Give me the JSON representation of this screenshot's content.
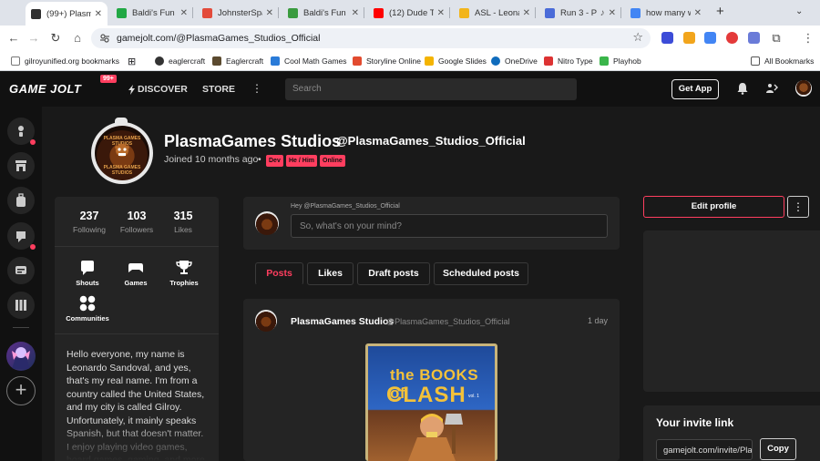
{
  "browser": {
    "tabs": [
      {
        "title": "(99+) Plasma",
        "color": "#2f2f2f",
        "active": true
      },
      {
        "title": "Baldi's Fun N",
        "color": "#22a845",
        "active": false
      },
      {
        "title": "JohnsterSpa",
        "color": "#e34b3b",
        "active": false
      },
      {
        "title": "Baldi's Fun N",
        "color": "#3a9b3f",
        "active": false
      },
      {
        "title": "(12) Dude Th",
        "color": "#ff0000",
        "active": false
      },
      {
        "title": "ASL - Leona",
        "color": "#f2b51c",
        "active": false
      },
      {
        "title": "Run 3 - Pl",
        "color": "#4a6bd8",
        "active": false
      },
      {
        "title": "how many w",
        "color": "#4285f4",
        "active": false
      }
    ],
    "new_tab": "+",
    "tab_menu": "⌄",
    "url": "gamejolt.com/@PlasmaGames_Studios_Official",
    "bookmarks": [
      {
        "label": "gilroyunified.org bookmarks",
        "color": "#777"
      },
      {
        "label": "eaglercraft",
        "color": "#333"
      },
      {
        "label": "Eaglercraft",
        "color": "#5b4a2f"
      },
      {
        "label": "Cool Math Games",
        "color": "#2a7bd8"
      },
      {
        "label": "Storyline Online",
        "color": "#e24b2f"
      },
      {
        "label": "Google Slides",
        "color": "#f4b400"
      },
      {
        "label": "OneDrive",
        "color": "#0f6cbd"
      },
      {
        "label": "Nitro Type",
        "color": "#d33"
      },
      {
        "label": "Playhob",
        "color": "#3ab54a"
      }
    ],
    "all_bookmarks": "All Bookmarks",
    "extension_colors": [
      "#3c4cd8",
      "#f2a51c",
      "#4285f4",
      "#e43a3a",
      "#6a7bd8"
    ]
  },
  "site": {
    "logo": "GAME JOLT",
    "notif_badge": "99+",
    "nav": {
      "discover": "DISCOVER",
      "store": "STORE"
    },
    "search_placeholder": "Search",
    "get_app": "Get App"
  },
  "profile": {
    "display_name": "PlasmaGames Studios",
    "handle": "@PlasmaGames_Studios_Official",
    "joined": "Joined 10 months ago",
    "tags": [
      "Dev",
      "He / Him",
      "Online"
    ],
    "stats": [
      {
        "value": "237",
        "label": "Following"
      },
      {
        "value": "103",
        "label": "Followers"
      },
      {
        "value": "315",
        "label": "Likes"
      }
    ],
    "quick_links": [
      "Shouts",
      "Games",
      "Trophies",
      "Communities"
    ],
    "bio": "Hello everyone, my name is Leonardo Sandoval, and yes, that's my real name. I'm from a country called the United States, and my city is called Gilroy. Unfortunately, it mainly speaks Spanish, but that doesn't matter. I enjoy playing video games, board games, gaming, and more. It's",
    "avatar_text": [
      "PLASMA GAMES STUDIOS",
      "PLASMA GAMES STUDIOS"
    ]
  },
  "composer": {
    "greeting": "Hey @PlasmaGames_Studios_Official",
    "placeholder": "So, what's on your mind?"
  },
  "feed_tabs": [
    "Posts",
    "Likes",
    "Draft posts",
    "Scheduled posts"
  ],
  "post": {
    "author": "PlasmaGames Studios",
    "handle": "@PlasmaGames_Studios_Official",
    "time": "1 day",
    "image_title_top": "the BOOKS of",
    "image_title_main": "CLASH",
    "image_vol": "vol. 1"
  },
  "sidebar": {
    "edit_profile": "Edit profile",
    "more": "⋮",
    "invite_title": "Your invite link",
    "invite_value": "gamejolt.com/invite/PlasmaGames",
    "copy": "Copy"
  },
  "colors": {
    "accent": "#ff3e5f",
    "panel": "#242424",
    "background": "#191919"
  }
}
